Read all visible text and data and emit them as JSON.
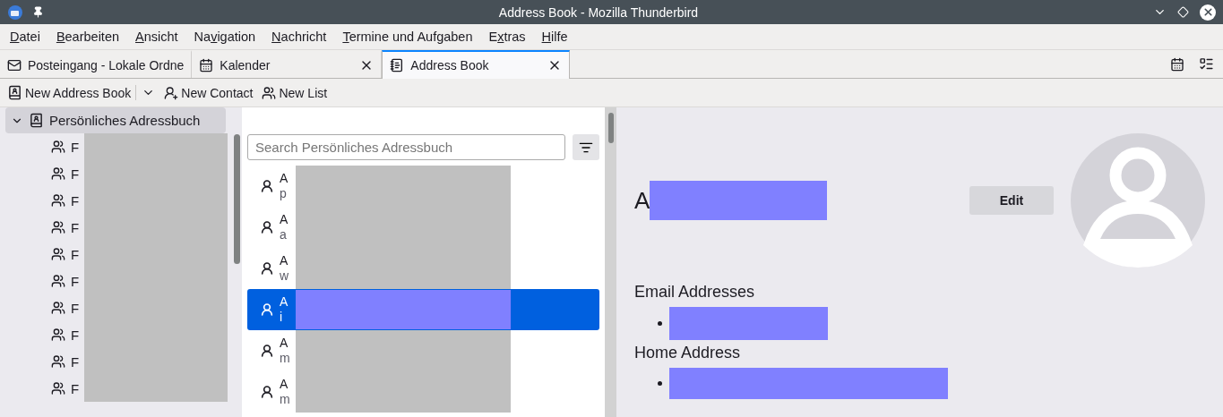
{
  "window": {
    "title": "Address Book - Mozilla Thunderbird"
  },
  "menu": [
    {
      "label": "Datei"
    },
    {
      "label": "Bearbeiten"
    },
    {
      "label": "Ansicht"
    },
    {
      "label": "Navigation"
    },
    {
      "label": "Nachricht"
    },
    {
      "label": "Termine und Aufgaben"
    },
    {
      "label": "Extras"
    },
    {
      "label": "Hilfe"
    }
  ],
  "tabs": [
    {
      "label": "Posteingang - Lokale Ordne",
      "kind": "mail",
      "selected": false,
      "closable": false
    },
    {
      "label": "Kalender",
      "kind": "calendar",
      "selected": false,
      "closable": true
    },
    {
      "label": "Address Book",
      "kind": "book",
      "selected": true,
      "closable": true
    }
  ],
  "toolbar": [
    {
      "label": "New Address Book",
      "kind": "book",
      "dropdown": true
    },
    {
      "label": "New Contact",
      "kind": "contact",
      "dropdown": false
    },
    {
      "label": "New List",
      "kind": "list",
      "dropdown": false
    }
  ],
  "sidebar": {
    "label": "Persönliches Adressbuch",
    "expanded": true,
    "selected": true,
    "children": [
      {
        "label": "F"
      },
      {
        "label": "F"
      },
      {
        "label": "F"
      },
      {
        "label": "F"
      },
      {
        "label": "F"
      },
      {
        "label": "F"
      },
      {
        "label": "F"
      },
      {
        "label": "F"
      },
      {
        "label": "F"
      },
      {
        "label": "F"
      }
    ]
  },
  "search": {
    "placeholder": "Search Persönliches Adressbuch"
  },
  "contacts": [
    {
      "name": "A",
      "detail": "p",
      "selected": false
    },
    {
      "name": "A",
      "detail": "a",
      "selected": false
    },
    {
      "name": "A",
      "detail": "w",
      "selected": false
    },
    {
      "name": "A",
      "detail": "i",
      "selected": true
    },
    {
      "name": "A",
      "detail": "m",
      "selected": false
    },
    {
      "name": "A",
      "detail": "m",
      "selected": false
    }
  ],
  "details": {
    "name": "A",
    "edit": "Edit",
    "sections": [
      {
        "heading": "Email Addresses"
      },
      {
        "heading": "Home Address"
      }
    ]
  }
}
